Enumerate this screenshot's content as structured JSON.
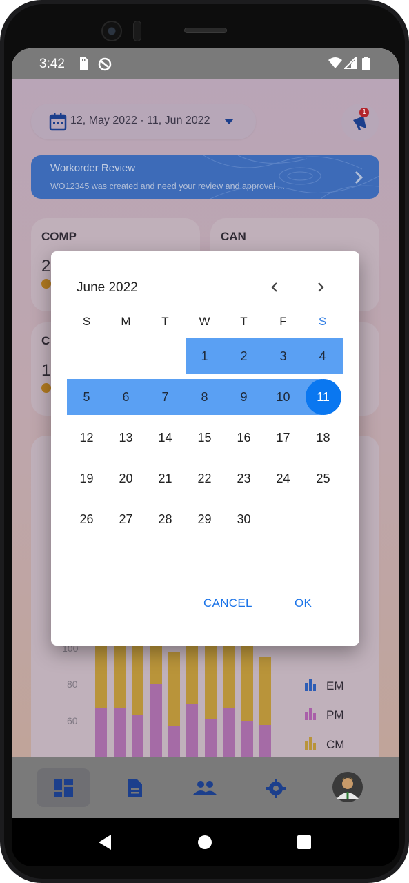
{
  "status": {
    "time": "3:42"
  },
  "header": {
    "date_range": "12, May 2022 - 11, Jun 2022",
    "notification_count": "1"
  },
  "banner": {
    "title": "Workorder Review",
    "subtitle": "WO12345 was created and need your review and approval ..."
  },
  "kpis": [
    {
      "label": "COMP",
      "value": "2"
    },
    {
      "label": "CAN",
      "value": ""
    },
    {
      "label": "C",
      "value": "1"
    }
  ],
  "chart": {
    "y_ticks": [
      "100",
      "80",
      "60"
    ],
    "legend": [
      {
        "name": "EM",
        "color": "#1f5fd0"
      },
      {
        "name": "PM",
        "color": "#b54fb0"
      },
      {
        "name": "CM",
        "color": "#c9991c"
      }
    ]
  },
  "dialog": {
    "month_label": "June 2022",
    "weekdays": [
      "S",
      "M",
      "T",
      "W",
      "T",
      "F",
      "S"
    ],
    "days": [
      "1",
      "2",
      "3",
      "4",
      "5",
      "6",
      "7",
      "8",
      "9",
      "10",
      "11",
      "12",
      "13",
      "14",
      "15",
      "16",
      "17",
      "18",
      "19",
      "20",
      "21",
      "22",
      "23",
      "24",
      "25",
      "26",
      "27",
      "28",
      "29",
      "30"
    ],
    "selected_day": "11",
    "range_days": [
      "1",
      "2",
      "3",
      "4",
      "5",
      "6",
      "7",
      "8",
      "9",
      "10",
      "11"
    ],
    "cancel_label": "CANCEL",
    "ok_label": "OK"
  },
  "colors": {
    "accent": "#1a73e8",
    "range": "#5aa0f3",
    "selected": "#0a77f0"
  }
}
